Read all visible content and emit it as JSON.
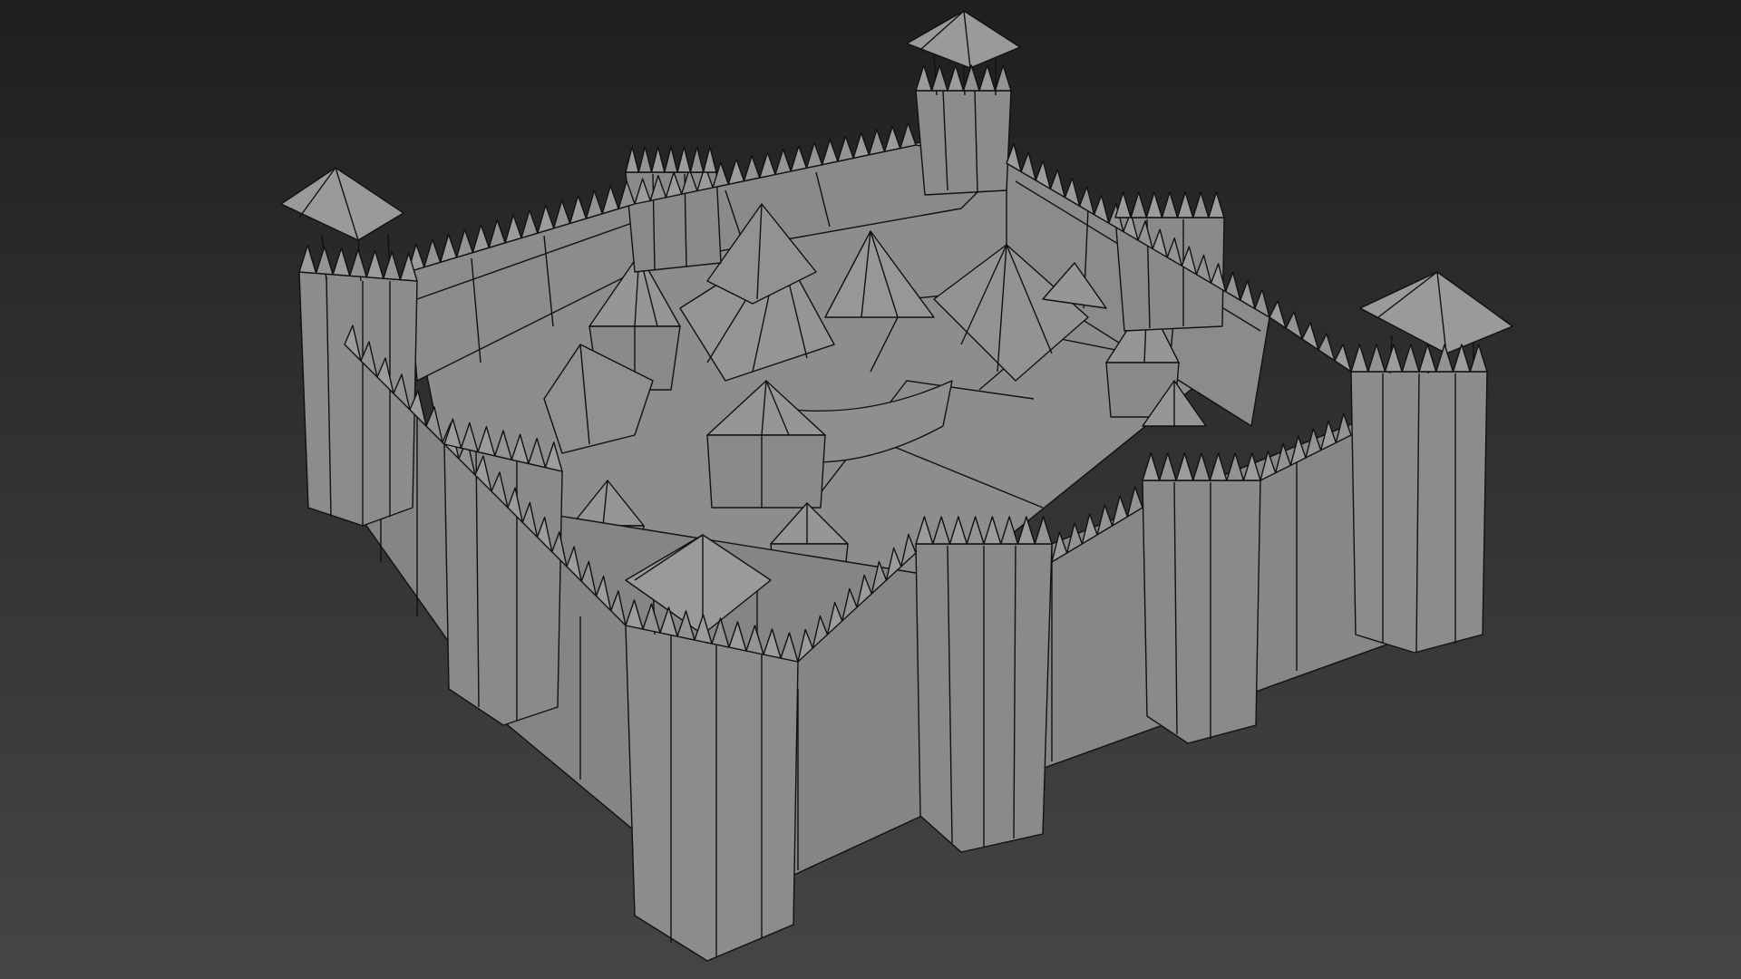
{
  "viewport": {
    "label": "",
    "background": [
      "#1f1f1f",
      "#454545"
    ],
    "shading": "gray-wireframe-on-shaded",
    "mesh_color": "#8e8e8e",
    "wire_color": "#111111"
  },
  "model": {
    "subject": "castle-fortress",
    "towers": 4,
    "watchtowers": 4
  }
}
